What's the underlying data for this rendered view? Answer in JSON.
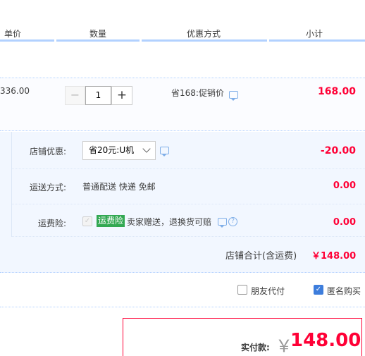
{
  "header": {
    "col_price": "单价",
    "col_qty": "数量",
    "col_discount": "优惠方式",
    "col_subtotal": "小计"
  },
  "item": {
    "unit_price": "336.00",
    "qty_minus": "−",
    "qty_value": "1",
    "qty_plus": "+",
    "promo": "省168:促销价",
    "subtotal": "168.00"
  },
  "shop": {
    "coupon_label": "店铺优惠:",
    "coupon_value": "省20元:U机",
    "coupon_amount": "-20.00",
    "shipping_label": "运送方式:",
    "shipping_value": "普通配送 快递 免邮",
    "shipping_amount": "0.00",
    "insurance_label": "运费险:",
    "insurance_badge": "运费险",
    "insurance_text": "卖家赠送，退换货可赔",
    "insurance_amount": "0.00",
    "total_label": "店铺合计(含运费)",
    "total_value": "￥148.00"
  },
  "options": {
    "friend_pay": "朋友代付",
    "anonymous": "匿名购买",
    "friend_pay_checked": false,
    "anonymous_checked": true
  },
  "payment": {
    "label": "实付款:",
    "currency": "￥",
    "amount": "148.00"
  },
  "icons": {
    "chat": "chat-bubble-icon",
    "question": "question-icon",
    "chevron": "chevron-down-icon",
    "check": "check-icon"
  },
  "colors": {
    "price_red": "#ff0036",
    "accent_blue": "#b2d1ff",
    "shop_bg": "#f2f7ff",
    "insurance_green": "#32a852",
    "checkbox_blue": "#3d7ddc"
  }
}
